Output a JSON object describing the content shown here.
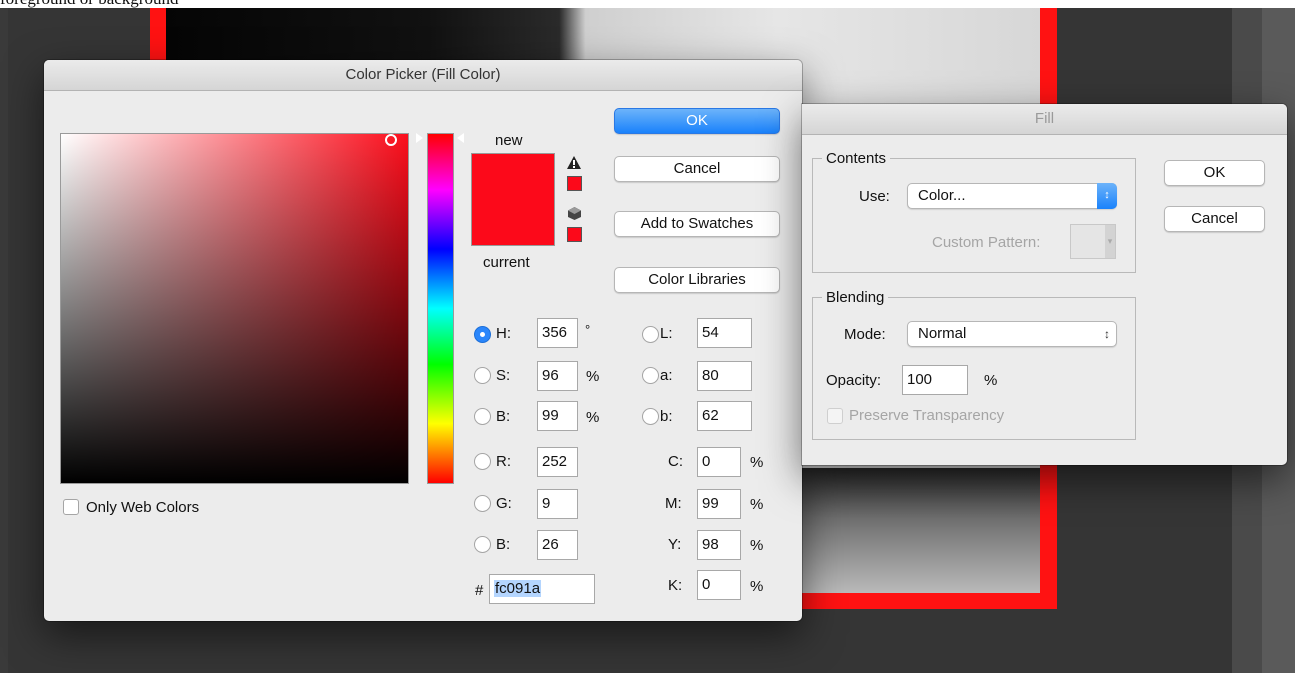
{
  "caption": {
    "text": "foreground or background"
  },
  "color_picker": {
    "title": "Color Picker (Fill Color)",
    "new_label": "new",
    "current_label": "current",
    "new_color": "#fc091a",
    "current_color": "#fc091a",
    "buttons": {
      "ok": "OK",
      "cancel": "Cancel",
      "add_to_swatches": "Add to Swatches",
      "color_libraries": "Color Libraries"
    },
    "only_web_colors": "Only Web Colors",
    "hsb": {
      "h": {
        "label": "H:",
        "value": "356",
        "unit": "°",
        "selected": true
      },
      "s": {
        "label": "S:",
        "value": "96",
        "unit": "%"
      },
      "b": {
        "label": "B:",
        "value": "99",
        "unit": "%"
      }
    },
    "rgb": {
      "r": {
        "label": "R:",
        "value": "252"
      },
      "g": {
        "label": "G:",
        "value": "9"
      },
      "b": {
        "label": "B:",
        "value": "26"
      }
    },
    "lab": {
      "l": {
        "label": "L:",
        "value": "54"
      },
      "a": {
        "label": "a:",
        "value": "80"
      },
      "b": {
        "label": "b:",
        "value": "62"
      }
    },
    "cmyk": {
      "c": {
        "label": "C:",
        "value": "0",
        "unit": "%"
      },
      "m": {
        "label": "M:",
        "value": "99",
        "unit": "%"
      },
      "y": {
        "label": "Y:",
        "value": "98",
        "unit": "%"
      },
      "k": {
        "label": "K:",
        "value": "0",
        "unit": "%"
      }
    },
    "hex": {
      "label": "#",
      "value": "fc091a"
    }
  },
  "fill_dialog": {
    "title": "Fill",
    "contents": {
      "legend": "Contents",
      "use_label": "Use:",
      "use_value": "Color...",
      "custom_pattern_label": "Custom Pattern:"
    },
    "blending": {
      "legend": "Blending",
      "mode_label": "Mode:",
      "mode_value": "Normal",
      "opacity_label": "Opacity:",
      "opacity_value": "100",
      "opacity_unit": "%",
      "preserve_transparency": "Preserve Transparency"
    },
    "buttons": {
      "ok": "OK",
      "cancel": "Cancel"
    }
  },
  "icons": {
    "gamut_warning": "warning-triangle-icon",
    "web_safe": "cube-icon",
    "popup_arrows": "chevron-updown-icon"
  },
  "accent_color": "#1a82fb"
}
